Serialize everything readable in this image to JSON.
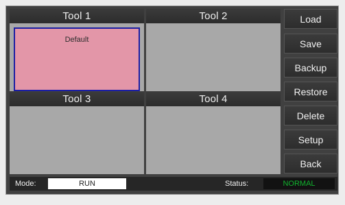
{
  "tools": [
    {
      "title": "Tool 1",
      "content": "Default",
      "active": true
    },
    {
      "title": "Tool 2",
      "content": "",
      "active": false
    },
    {
      "title": "Tool 3",
      "content": "",
      "active": false
    },
    {
      "title": "Tool 4",
      "content": "",
      "active": false
    }
  ],
  "buttons": {
    "load": "Load",
    "save": "Save",
    "backup": "Backup",
    "restore": "Restore",
    "delete": "Delete",
    "setup": "Setup",
    "back": "Back"
  },
  "status_bar": {
    "mode_label": "Mode:",
    "mode_value": "RUN",
    "status_label": "Status:",
    "status_value": "NORMAL"
  },
  "colors": {
    "active_fill": "#e396a8",
    "active_border": "#1b1ea3",
    "status_ok": "#10b22d"
  }
}
